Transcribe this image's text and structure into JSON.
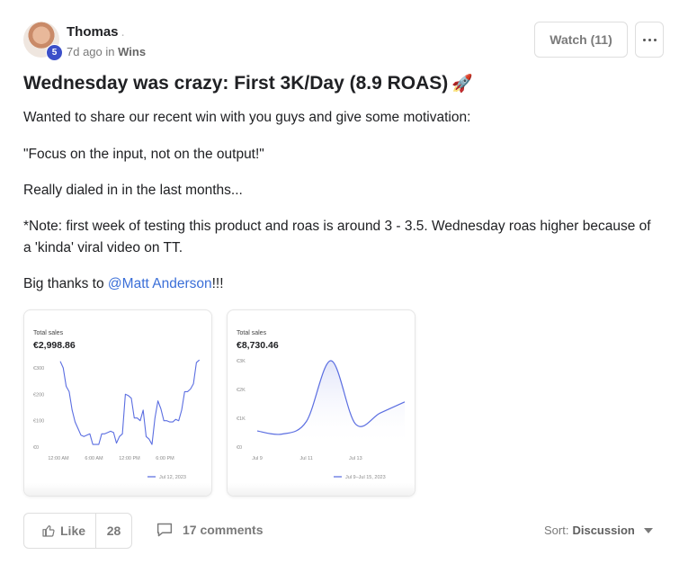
{
  "post": {
    "author": "Thomas",
    "author_dot": ".",
    "level": "5",
    "time_ago": "7d ago in",
    "category": "Wins",
    "title": "Wednesday was crazy: First 3K/Day (8.9 ROAS)",
    "title_emoji": "🚀",
    "body": {
      "p1": "Wanted to share our recent win with you guys and give some motivation:",
      "p2": "\"Focus on the input, not on the output!\"",
      "p3": "Really dialed in in the last months...",
      "p4": "*Note: first week of testing this product and roas is around 3 - 3.5. Wednesday roas higher because of a 'kinda' viral video on TT.",
      "p5_prefix": "Big thanks to ",
      "p5_mention": "@Matt Anderson",
      "p5_suffix": "!!!"
    }
  },
  "actions": {
    "watch_label": "Watch (11)",
    "like_label": "Like",
    "like_count": "28",
    "comments_label": "17 comments",
    "sort_label": "Sort:",
    "sort_value": "Discussion"
  },
  "colors": {
    "accent": "#3b4fc9",
    "mention": "#3b6fd8",
    "line": "#5b6ee1"
  },
  "icons": {
    "more": "more-dots-icon",
    "like": "thumbs-up-icon",
    "comments": "speech-bubble-icon",
    "sort": "caret-down-icon"
  },
  "chart_data": [
    {
      "type": "line",
      "title": "Total sales",
      "total": "€2,998.86",
      "y_ticks": [
        "€300",
        "€200",
        "€100",
        "€0"
      ],
      "ylim": [
        0,
        300
      ],
      "x_ticks": [
        "12:00 AM",
        "6:00 AM",
        "12:00 PM",
        "6:00 PM"
      ],
      "legend": "Jul 12, 2023",
      "series": [
        {
          "x": [
            0,
            0.5,
            1,
            1.5,
            2,
            2.5,
            3,
            3.5,
            4,
            4.5,
            5,
            5.5,
            6,
            6.5,
            7,
            7.5,
            8,
            8.5,
            9,
            9.5,
            10,
            10.5,
            11,
            11.5,
            12,
            12.5,
            13,
            13.5,
            14,
            14.5,
            15,
            15.5,
            16,
            16.5,
            17,
            17.5,
            18,
            18.5,
            19,
            19.5,
            20,
            20.5,
            21,
            21.5,
            22,
            22.5,
            23,
            23.5
          ],
          "y": [
            325,
            300,
            230,
            210,
            140,
            95,
            70,
            45,
            40,
            45,
            50,
            10,
            10,
            10,
            50,
            50,
            55,
            60,
            55,
            15,
            40,
            50,
            200,
            195,
            185,
            110,
            110,
            100,
            140,
            40,
            30,
            10,
            110,
            175,
            145,
            100,
            100,
            95,
            95,
            105,
            100,
            140,
            210,
            210,
            220,
            240,
            320,
            330
          ]
        }
      ]
    },
    {
      "type": "line",
      "title": "Total sales",
      "total": "€8,730.46",
      "y_ticks": [
        "€3K",
        "€2K",
        "€1K",
        "€0"
      ],
      "ylim": [
        0,
        3000
      ],
      "x_ticks": [
        "Jul 9",
        "Jul 11",
        "Jul 13"
      ],
      "x": [
        "Jul 9",
        "Jul 10",
        "Jul 11",
        "Jul 12",
        "Jul 13",
        "Jul 14",
        "Jul 15"
      ],
      "legend": "Jul 9–Jul 15, 2023",
      "series": [
        {
          "values": [
            560,
            450,
            890,
            3000,
            800,
            1180,
            1570
          ]
        }
      ]
    }
  ]
}
